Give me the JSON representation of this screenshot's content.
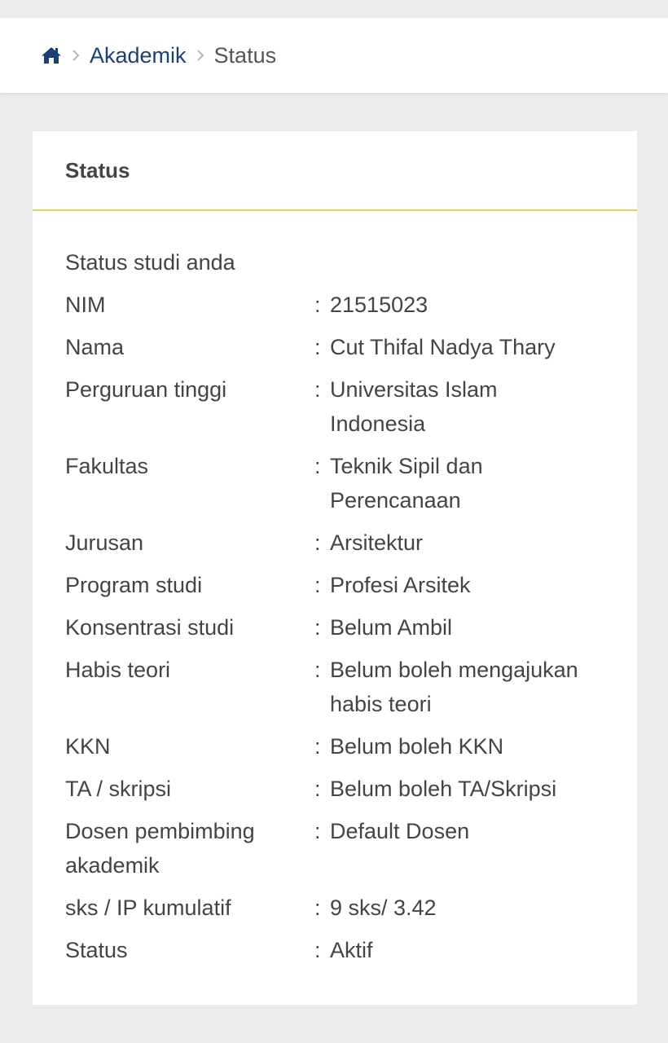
{
  "breadcrumb": {
    "home_icon": "home-icon",
    "separator_icon": "chevron-right-icon",
    "items": [
      "Akademik",
      "Status"
    ]
  },
  "card": {
    "title": "Status",
    "intro": "Status studi anda",
    "separator": ":",
    "rows": [
      {
        "label": "NIM",
        "value": "21515023"
      },
      {
        "label": "Nama",
        "value": "Cut Thifal Nadya Thary"
      },
      {
        "label": "Perguruan tinggi",
        "value": "Universitas Islam Indonesia"
      },
      {
        "label": "Fakultas",
        "value": "Teknik Sipil dan Perencanaan"
      },
      {
        "label": "Jurusan",
        "value": "Arsitektur"
      },
      {
        "label": "Program studi",
        "value": "Profesi Arsitek"
      },
      {
        "label": "Konsentrasi studi",
        "value": "Belum Ambil"
      },
      {
        "label": "Habis teori",
        "value": "Belum boleh mengajukan habis teori"
      },
      {
        "label": "KKN",
        "value": "Belum boleh KKN"
      },
      {
        "label": "TA / skripsi",
        "value": "Belum boleh TA/Skripsi"
      },
      {
        "label": "Dosen pembimbing akademik",
        "value": "Default Dosen"
      },
      {
        "label": "sks / IP kumulatif",
        "value": "9 sks/ 3.42"
      },
      {
        "label": "Status",
        "value": "Aktif"
      }
    ]
  },
  "colors": {
    "breadcrumb_link": "#1c3f76",
    "header_border": "#e2d35a",
    "text": "#444444",
    "background": "#ececec"
  }
}
